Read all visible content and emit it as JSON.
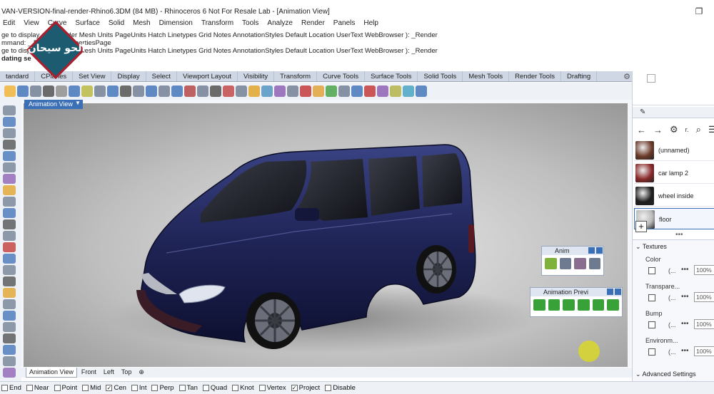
{
  "window": {
    "title": "VAN-VERSION-final-render-Rhino6.3DM (84 MB) - Rhinoceros 6 Not For Resale Lab - [Animation View]",
    "restore_glyph": "❐"
  },
  "menu": [
    "Edit",
    "View",
    "Curve",
    "Surface",
    "Solid",
    "Mesh",
    "Dimension",
    "Transform",
    "Tools",
    "Analyze",
    "Render",
    "Panels",
    "Help"
  ],
  "command_history": [
    "ge to display or 0 Render Mesh Units PageUnits Hatch Linetypes Grid Notes AnnotationStyles Default Location UserText WebBrowser ): _Render",
    "mmand: _ DocumentPropertiesPage",
    "ge to display or 0 Render Mesh Units PageUnits Hatch Linetypes Grid Notes AnnotationStyles Default Location UserText WebBrowser ): _Render"
  ],
  "status_line": "dating se",
  "logo_text": "الحو سيحان",
  "ribbon_tabs": [
    "tandard",
    "CPlanes",
    "Set View",
    "Display",
    "Select",
    "Viewport Layout",
    "Visibility",
    "Transform",
    "Curve Tools",
    "Surface Tools",
    "Solid Tools",
    "Mesh Tools",
    "Render Tools",
    "Drafting"
  ],
  "viewport": {
    "title": "Animation View",
    "bottom_tabs": [
      "Animation View",
      "Front",
      "Left",
      "Top"
    ],
    "add_tab_glyph": "⊕"
  },
  "float_panels": {
    "animation_tools": {
      "title": "Anim"
    },
    "animation_preview": {
      "title": "Animation Previ"
    }
  },
  "osnaps": [
    {
      "label": "End",
      "checked": false
    },
    {
      "label": "Near",
      "checked": false
    },
    {
      "label": "Point",
      "checked": false
    },
    {
      "label": "Mid",
      "checked": false
    },
    {
      "label": "Cen",
      "checked": true
    },
    {
      "label": "Int",
      "checked": false
    },
    {
      "label": "Perp",
      "checked": false
    },
    {
      "label": "Tan",
      "checked": false
    },
    {
      "label": "Quad",
      "checked": false
    },
    {
      "label": "Knot",
      "checked": false
    },
    {
      "label": "Vertex",
      "checked": false
    },
    {
      "label": "Project",
      "checked": true
    },
    {
      "label": "Disable",
      "checked": false
    }
  ],
  "right_panel": {
    "nav_label": "r.",
    "materials": [
      {
        "name": "(unnamed)",
        "thumb_color": "#6b3b2a"
      },
      {
        "name": "car lamp 2",
        "thumb_color": "#8a2a2a"
      },
      {
        "name": "wheel inside",
        "thumb_color": "#1e1e1e"
      },
      {
        "name": "floor",
        "thumb_color": "#b9b9b9",
        "selected": true
      }
    ],
    "add_glyph": "+",
    "more_glyph": "•••",
    "textures_title": "Textures",
    "textures": [
      {
        "label": "Color",
        "value": "100%"
      },
      {
        "label": "Transpare...",
        "value": "100%"
      },
      {
        "label": "Bump",
        "value": "100%"
      },
      {
        "label": "Environm...",
        "value": "100%"
      }
    ],
    "texture_i": "(...",
    "texture_more": "•••",
    "advanced_title": "Advanced Settings"
  },
  "colors": {
    "accent": "#3b6fb6",
    "car_body": "#1f2456",
    "logo_bg": "#1d5c70",
    "logo_border": "#b11c2a"
  }
}
